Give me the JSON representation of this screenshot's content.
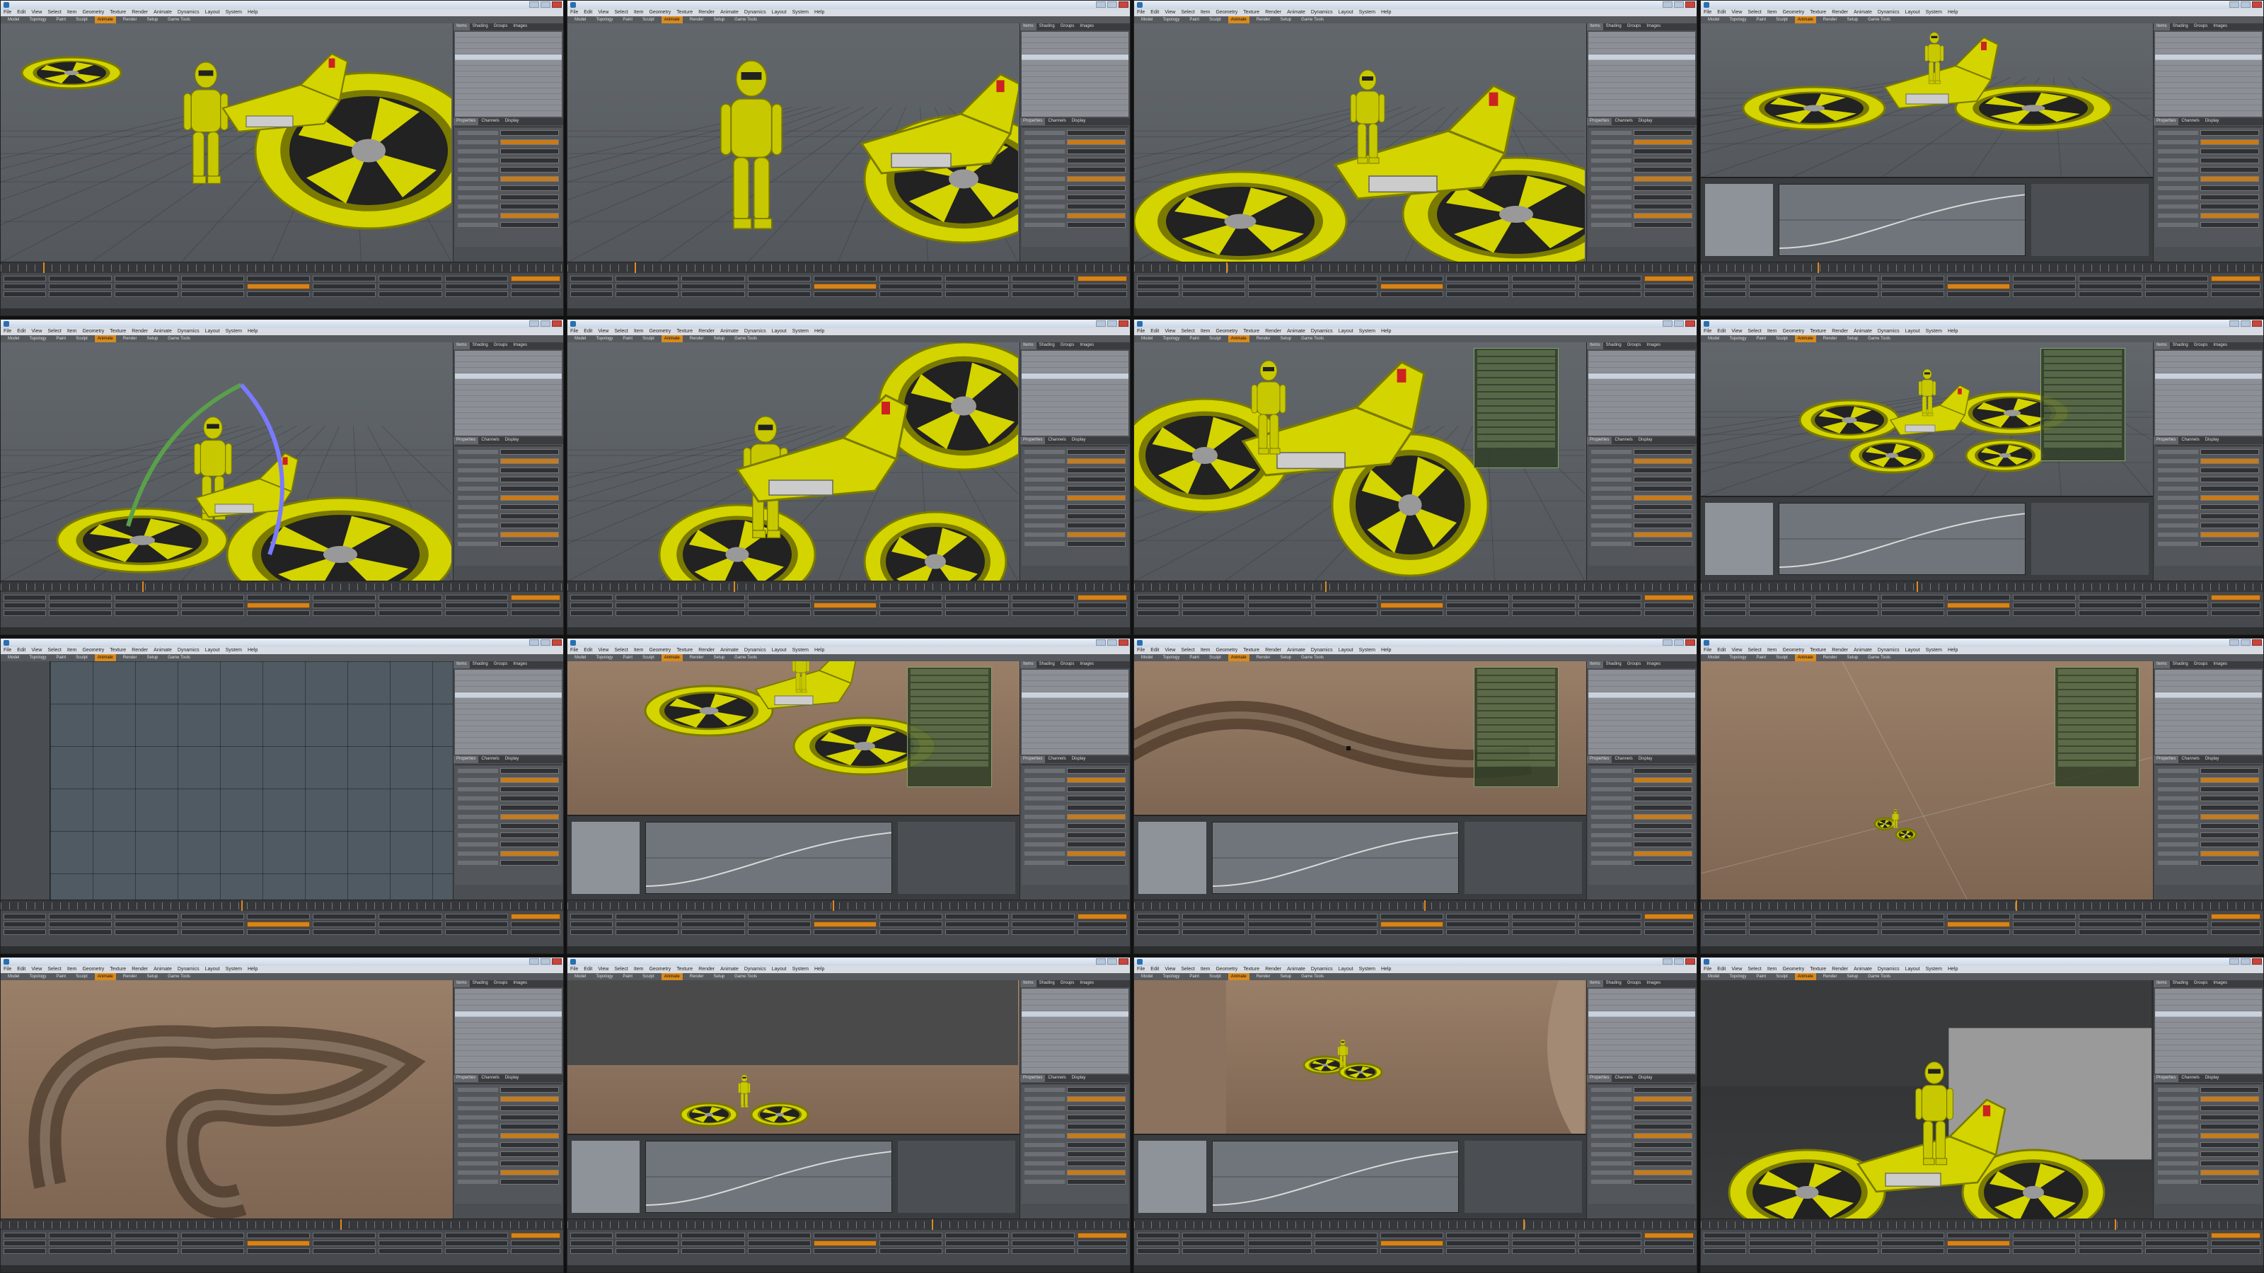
{
  "app": {
    "menu": [
      "File",
      "Edit",
      "View",
      "Select",
      "Item",
      "Geometry",
      "Texture",
      "Render",
      "Animate",
      "Dynamics",
      "Layout",
      "System",
      "Help"
    ],
    "toolbar": [
      "Model",
      "Topology",
      "Paint",
      "Sculpt",
      "Animate",
      "Render",
      "Setup",
      "Game Tools"
    ],
    "active_tool": "Animate",
    "panel_tabs": [
      "Items",
      "Shading",
      "Groups",
      "Images"
    ],
    "panel_tabs2": [
      "Properties",
      "Channels",
      "Display"
    ]
  },
  "colors": {
    "accent": "#d5831b",
    "vehicle": "#d4d400",
    "vehicle_dark": "#7a7a00",
    "rider": "#c8c800",
    "brown_ground": "#8c735e"
  },
  "tiles": [
    {
      "id": 1,
      "viewport": "gray",
      "scene": "close-fans-rider-standing",
      "panel": "items"
    },
    {
      "id": 2,
      "viewport": "gray",
      "scene": "rider-standing-bike-seat",
      "panel": "items"
    },
    {
      "id": 3,
      "viewport": "gray",
      "scene": "rider-on-bike-side",
      "panel": "items"
    },
    {
      "id": 4,
      "viewport": "gray",
      "scene": "wide-bike-dopesheet",
      "panel": "items"
    },
    {
      "id": 5,
      "viewport": "gray",
      "scene": "rig-arcs",
      "panel": "items"
    },
    {
      "id": 6,
      "viewport": "gray",
      "scene": "rider-closeup-front",
      "panel": "items"
    },
    {
      "id": 7,
      "viewport": "gray",
      "scene": "bike-angle-hud",
      "panel": "items"
    },
    {
      "id": 8,
      "viewport": "gray",
      "scene": "bike-top-graph",
      "panel": "items"
    },
    {
      "id": 9,
      "viewport": "bluegrid",
      "scene": "topdown-grid-small-bike",
      "panel": "items"
    },
    {
      "id": 10,
      "viewport": "brown",
      "scene": "bike-on-ground-graph",
      "panel": "items"
    },
    {
      "id": 11,
      "viewport": "brown",
      "scene": "track-curve-graph",
      "panel": "items"
    },
    {
      "id": 12,
      "viewport": "brown",
      "scene": "tiny-bike-far",
      "panel": "items"
    },
    {
      "id": 13,
      "viewport": "brown",
      "scene": "track-loop-fence",
      "panel": "items"
    },
    {
      "id": 14,
      "viewport": "brown",
      "scene": "bike-node-editor",
      "panel": "items"
    },
    {
      "id": 15,
      "viewport": "brown",
      "scene": "bike-ramp-graph",
      "panel": "items"
    },
    {
      "id": 16,
      "viewport": "dark",
      "scene": "rider-close-right",
      "panel": "items"
    }
  ]
}
